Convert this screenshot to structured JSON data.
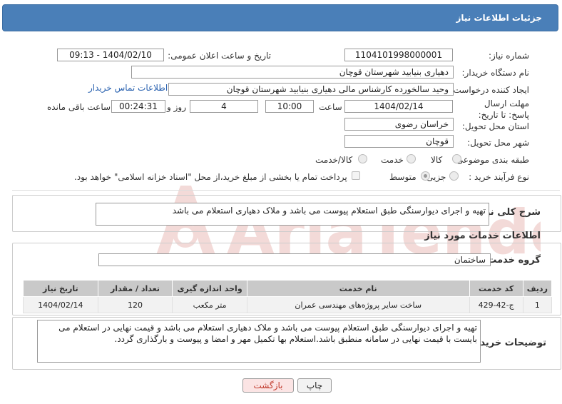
{
  "header": {
    "title": "جزئیات اطلاعات نیاز"
  },
  "fields": {
    "need_number_label": "شماره نیاز:",
    "need_number": "1104101998000001",
    "announce_label": "تاریخ و ساعت اعلان عمومی:",
    "announce_value": "1404/02/10 - 09:13",
    "buyer_org_label": "نام دستگاه خریدار:",
    "buyer_org": "دهیاری بنیابید شهرستان قوچان",
    "requester_label": "ایجاد کننده درخواست:",
    "requester": "وحید سالخورده کارشناس مالی دهیاری بنیابید شهرستان قوچان",
    "contact_link": "اطلاعات تماس خریدار",
    "deadline_label": "مهلت ارسال پاسخ: تا تاریخ:",
    "deadline_date": "1404/02/14",
    "time_label": "ساعت",
    "deadline_time": "10:00",
    "days_value": "4",
    "days_label": "روز و",
    "remaining_value": "00:24:31",
    "remaining_label": "ساعت باقی مانده",
    "province_label": "استان محل تحویل:",
    "province": "خراسان رضوی",
    "city_label": "شهر محل تحویل:",
    "city": "قوچان",
    "category_label": "طبقه بندی موضوعی:",
    "category_options": [
      "کالا",
      "خدمت",
      "کالا/خدمت"
    ],
    "process_label": "نوع فرآیند خرید :",
    "process_options": [
      "جزیی",
      "متوسط"
    ],
    "payment_note": "پرداخت تمام یا بخشی از مبلغ خرید،از محل \"اسناد خزانه اسلامی\" خواهد بود."
  },
  "summary": {
    "label": "شرح کلی نیاز:",
    "text": "تهیه و اجرای دیوارسنگی طبق استعلام پیوست می باشد و ملاک دهیاری استعلام می باشد"
  },
  "services": {
    "section_title": "اطلاعات خدمات مورد نیاز",
    "group_label": "گروه خدمت:",
    "group_value": "ساختمان",
    "columns": [
      "ردیف",
      "کد خدمت",
      "نام خدمت",
      "واحد اندازه گیری",
      "تعداد / مقدار",
      "تاریخ نیاز"
    ],
    "rows": [
      [
        "1",
        "ج-42-429",
        "ساخت سایر پروژه‌های مهندسی عمران",
        "متر مکعب",
        "120",
        "1404/02/14"
      ]
    ]
  },
  "buyer_notes": {
    "label": "توضیحات خریدار:",
    "text": "تهیه و اجرای دیوارسنگی طبق استعلام پیوست می باشد و ملاک دهیاری استعلام می باشد و قیمت نهایی در استعلام می بایست با قیمت نهایی در سامانه منطبق باشد.استعلام بها تکمیل مهر و امضا و پیوست و بارگذاری گردد."
  },
  "buttons": {
    "print": "چاپ",
    "back": "بازگشت"
  },
  "watermark": {
    "text": "AriaTender.neT"
  },
  "colors": {
    "header": "#4a7fb8",
    "link": "#2a62b0",
    "back_text": "#c0392b"
  }
}
